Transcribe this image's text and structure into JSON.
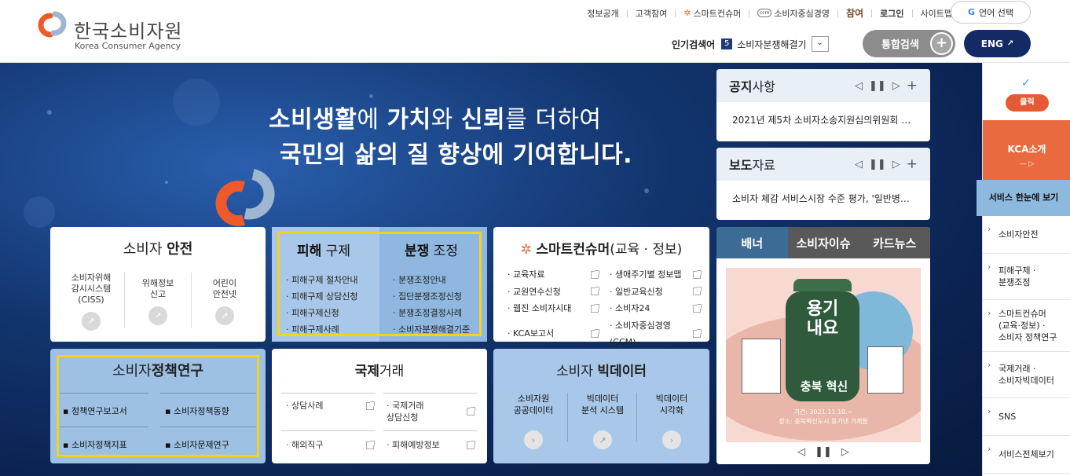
{
  "logo": {
    "ko": "한국소비자원",
    "en": "Korea Consumer Agency"
  },
  "util": {
    "items": [
      "정보공개",
      "고객참여",
      "스마트컨슈머",
      "소비자중심경영",
      "참여",
      "로그인",
      "사이트맵"
    ]
  },
  "lang_select": "언어 선택",
  "popular": {
    "label": "인기검색어",
    "rank": "5",
    "term": "소비자분쟁해결기"
  },
  "search_btn": "통합검색",
  "eng_btn": "ENG",
  "hero": {
    "line1_bold1": "소비생활",
    "line1_t1": "에 ",
    "line1_bold2": "가치",
    "line1_t2": "와 ",
    "line1_bold3": "신뢰",
    "line1_t3": "를 더하여",
    "line2": "국민의 삶의 질 향상에 기여합니다."
  },
  "safety": {
    "title_a": "소비자 ",
    "title_b": "안전",
    "cols": [
      "소비자위해\n감시시스템\n(CISS)",
      "위해정보\n신고",
      "어린이\n안전넷"
    ]
  },
  "relief": {
    "left_title_a": "피해",
    "left_title_b": " 구제",
    "right_title_a": "분쟁",
    "right_title_b": " 조정",
    "left": [
      "피해구제 절차안내",
      "피해구제 상담신청",
      "피해구제신청",
      "피해구제사례"
    ],
    "right": [
      "분쟁조정안내",
      "집단분쟁조정신청",
      "분쟁조정결정사례",
      "소비자분쟁해결기준"
    ]
  },
  "smart": {
    "title_a": "스마트컨슈머",
    "title_b": "(교육 · 정보)",
    "left": [
      "교육자료",
      "교원연수신청",
      "웹진 소비자시대",
      "KCA보고서"
    ],
    "right": [
      "생애주기별 정보맵",
      "일반교육신청",
      "소비자24",
      "소비자중심경영(CCM)"
    ]
  },
  "policy": {
    "title_a": "소비자",
    "title_b": "정책연구",
    "items": [
      "정책연구보고서",
      "소비자정책동향",
      "소비자정책지표",
      "소비자문제연구"
    ]
  },
  "intl": {
    "title_a": "국제",
    "title_b": "거래",
    "items": [
      "상담사례",
      "국제거래\n상담신청",
      "해외직구",
      "피해예방정보"
    ]
  },
  "big": {
    "title_a": "소비자 ",
    "title_b": "빅데이터",
    "cols": [
      "소비자원\n공공데이터",
      "빅데이터\n분석 시스템",
      "빅데이터\n시각화"
    ]
  },
  "notice": {
    "title_a": "공지",
    "title_b": "사항",
    "item": "2021년 제5차 소비자소송지원심의위원회 …"
  },
  "press": {
    "title_a": "보도",
    "title_b": "자료",
    "item": "소비자 체감 서비스시장 수준 평가, '일반병…"
  },
  "banner": {
    "tabs": [
      "배너",
      "소비자이슈",
      "카드뉴스"
    ],
    "poster_title": "용기내요",
    "poster_sub": "충북 혁신",
    "poster_date": "기간: 2021.11.10.~",
    "poster_place": "장소: 충북혁신도시 용기낸 가게들"
  },
  "sidebar": {
    "click": "클릭",
    "kca": "KCA소개",
    "service": "서비스 한눈에 보기",
    "items": [
      "소비자안전",
      "피해구제 ·\n분쟁조정",
      "스마트컨슈머\n(교육·정보) ·\n소비자 정책연구",
      "국제거래 ·\n소비자빅데이터",
      "SNS",
      "서비스전체보기"
    ]
  },
  "colors": {
    "navy": "#142a64",
    "orange": "#e86a3e",
    "yellow": "#f2d41f",
    "lightblue": "#a9c7e8"
  }
}
